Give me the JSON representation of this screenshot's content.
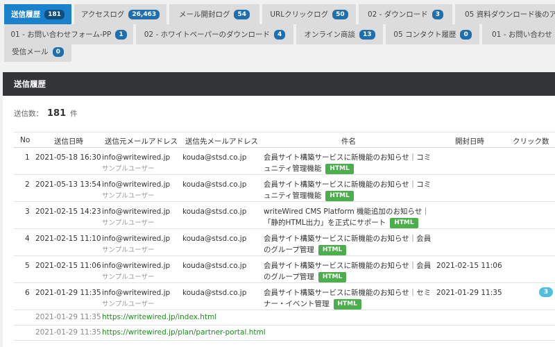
{
  "tabs": [
    [
      {
        "label": "送信履歴",
        "count": "181",
        "active": true
      },
      {
        "label": "アクセスログ",
        "count": "26,463"
      },
      {
        "label": "メール開封ログ",
        "count": "54"
      },
      {
        "label": "URLクリックログ",
        "count": "50"
      },
      {
        "label": "02 - ダウンロード",
        "count": "3"
      },
      {
        "label": "05 資料ダウンロード後のア",
        "count": ""
      }
    ],
    [
      {
        "label": "01 - お問い合わせフォーム-PP",
        "count": "1"
      },
      {
        "label": "02 - ホワイトペーパーのダウンロード",
        "count": "4"
      },
      {
        "label": "オンライン商談",
        "count": "13"
      },
      {
        "label": "05 コンタクト履歴",
        "count": "0"
      },
      {
        "label": "01 - お問い合わせ",
        "count": ""
      }
    ],
    [
      {
        "label": "受信メール",
        "count": "0"
      }
    ]
  ],
  "panel": {
    "title": "送信履歴",
    "count_label": "送信数：",
    "count_value": "181",
    "count_unit": "件"
  },
  "table": {
    "headers": {
      "no": "No",
      "sent_at": "送信日時",
      "from": "送信元メールアドレス",
      "to": "送信先メールアドレス",
      "subject": "件名",
      "opened_at": "開封日時",
      "clicks": "クリック数"
    },
    "rows": [
      {
        "no": "1",
        "sent_at": "2021-05-18 16:30",
        "from": "info@writewired.jp",
        "from_name": "サンプルユーザー",
        "to": "kouda@stsd.co.jp",
        "subject": "会員サイト構築サービスに新機能のお知らせ｜コミュニティ管理機能",
        "badge": "HTML",
        "opened_at": "",
        "clicks": ""
      },
      {
        "no": "2",
        "sent_at": "2021-05-13 13:54",
        "from": "info@writewired.jp",
        "from_name": "サンプルユーザー",
        "to": "kouda@stsd.co.jp",
        "subject": "会員サイト構築サービスに新機能のお知らせ｜コミュニティ管理機能",
        "badge": "HTML",
        "opened_at": "",
        "clicks": ""
      },
      {
        "no": "3",
        "sent_at": "2021-02-15 14:23",
        "from": "info@writewired.jp",
        "from_name": "サンプルユーザー",
        "to": "kouda@stsd.co.jp",
        "subject": "writeWired CMS Platform 機能追加のお知らせ｜「静的HTML出力」を正式にサポート",
        "badge": "HTML",
        "opened_at": "",
        "clicks": ""
      },
      {
        "no": "4",
        "sent_at": "2021-02-15 11:10",
        "from": "info@writewired.jp",
        "from_name": "サンプルユーザー",
        "to": "kouda@stsd.co.jp",
        "subject": "会員サイト構築サービスに新機能のお知らせ｜会員のグループ管理",
        "badge": "HTML",
        "opened_at": "",
        "clicks": ""
      },
      {
        "no": "5",
        "sent_at": "2021-02-15 11:06",
        "from": "info@writewired.jp",
        "from_name": "サンプルユーザー",
        "to": "kouda@stsd.co.jp",
        "subject": "会員サイト構築サービスに新機能のお知らせ｜会員のグループ管理",
        "badge": "HTML",
        "opened_at": "2021-02-15 11:06",
        "clicks": ""
      },
      {
        "no": "6",
        "sent_at": "2021-01-29 11:35",
        "from": "info@writewired.jp",
        "from_name": "サンプルユーザー",
        "to": "kouda@stsd.co.jp",
        "subject": "会員サイト構築サービスに新機能のお知らせ｜セミナー・イベント管理",
        "badge": "HTML",
        "opened_at": "2021-01-29 11:35",
        "clicks": "3"
      }
    ],
    "click_rows": [
      {
        "time": "2021-01-29 11:35",
        "url": "https://writewired.jp/index.html"
      },
      {
        "time": "2021-01-29 11:35",
        "url": "https://writewired.jp/plan/partner-portal.html"
      }
    ]
  }
}
